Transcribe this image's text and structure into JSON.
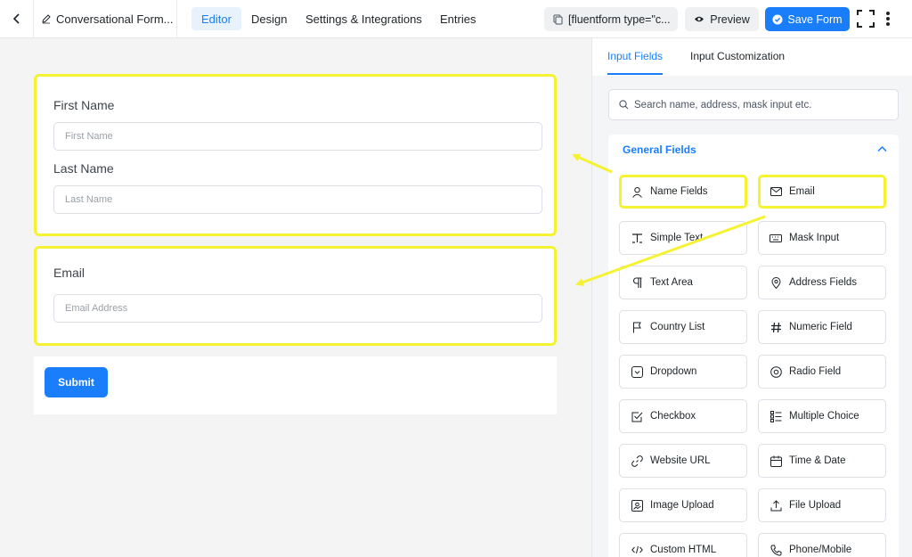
{
  "topbar": {
    "form_title": "Conversational Form...",
    "tabs": [
      "Editor",
      "Design",
      "Settings & Integrations",
      "Entries"
    ],
    "shortcode": "[fluentform type=\"c...",
    "preview_label": "Preview",
    "save_label": "Save Form"
  },
  "canvas": {
    "name_block": {
      "first_label": "First Name",
      "first_placeholder": "First Name",
      "last_label": "Last Name",
      "last_placeholder": "Last Name"
    },
    "email_block": {
      "label": "Email",
      "placeholder": "Email Address"
    },
    "submit_label": "Submit"
  },
  "sidebar": {
    "tabs": [
      "Input Fields",
      "Input Customization"
    ],
    "search_placeholder": "Search name, address, mask input etc.",
    "section_title": "General Fields",
    "fields": [
      {
        "label": "Name Fields",
        "icon": "user-icon",
        "highlighted": true
      },
      {
        "label": "Email",
        "icon": "envelope-icon",
        "highlighted": true
      },
      {
        "label": "Simple Text",
        "icon": "text-cursor-icon"
      },
      {
        "label": "Mask Input",
        "icon": "keyboard-icon"
      },
      {
        "label": "Text Area",
        "icon": "paragraph-icon"
      },
      {
        "label": "Address Fields",
        "icon": "map-pin-icon"
      },
      {
        "label": "Country List",
        "icon": "flag-icon"
      },
      {
        "label": "Numeric Field",
        "icon": "hash-icon"
      },
      {
        "label": "Dropdown",
        "icon": "dropdown-icon"
      },
      {
        "label": "Radio Field",
        "icon": "radio-icon"
      },
      {
        "label": "Checkbox",
        "icon": "checkbox-icon"
      },
      {
        "label": "Multiple Choice",
        "icon": "list-icon"
      },
      {
        "label": "Website URL",
        "icon": "link-icon"
      },
      {
        "label": "Time & Date",
        "icon": "calendar-icon"
      },
      {
        "label": "Image Upload",
        "icon": "image-icon"
      },
      {
        "label": "File Upload",
        "icon": "upload-icon"
      },
      {
        "label": "Custom HTML",
        "icon": "code-icon"
      },
      {
        "label": "Phone/Mobile",
        "icon": "phone-icon"
      }
    ]
  },
  "colors": {
    "accent": "#1a7efb",
    "highlight": "#f5f232",
    "canvas_bg": "#f4f4f4"
  }
}
